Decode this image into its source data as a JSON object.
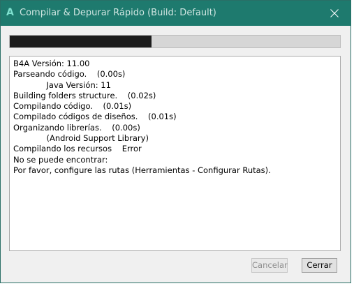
{
  "window": {
    "app_icon_glyph": "A",
    "title": "Compilar & Depurar Rápido (Build: Default)",
    "accent_color": "#1e7a6e"
  },
  "progress": {
    "value": 0.43
  },
  "log": {
    "lines": [
      "B4A Versión: 11.00",
      "Parseando código.    (0.00s)",
      "             Java Versión: 11",
      "Building folders structure.    (0.02s)",
      "Compilando código.    (0.01s)",
      "Compilado códigos de diseños.    (0.01s)",
      "Organizando librerías.    (0.00s)",
      "             (Android Support Library)",
      "Compilando los recursos    Error",
      "No se puede encontrar:",
      "Por favor, configure las rutas (Herramientas - Configurar Rutas)."
    ]
  },
  "buttons": {
    "cancel_label": "Cancelar",
    "close_label": "Cerrar"
  },
  "icons": {
    "app": "b4a-app-icon",
    "close": "close-icon"
  }
}
